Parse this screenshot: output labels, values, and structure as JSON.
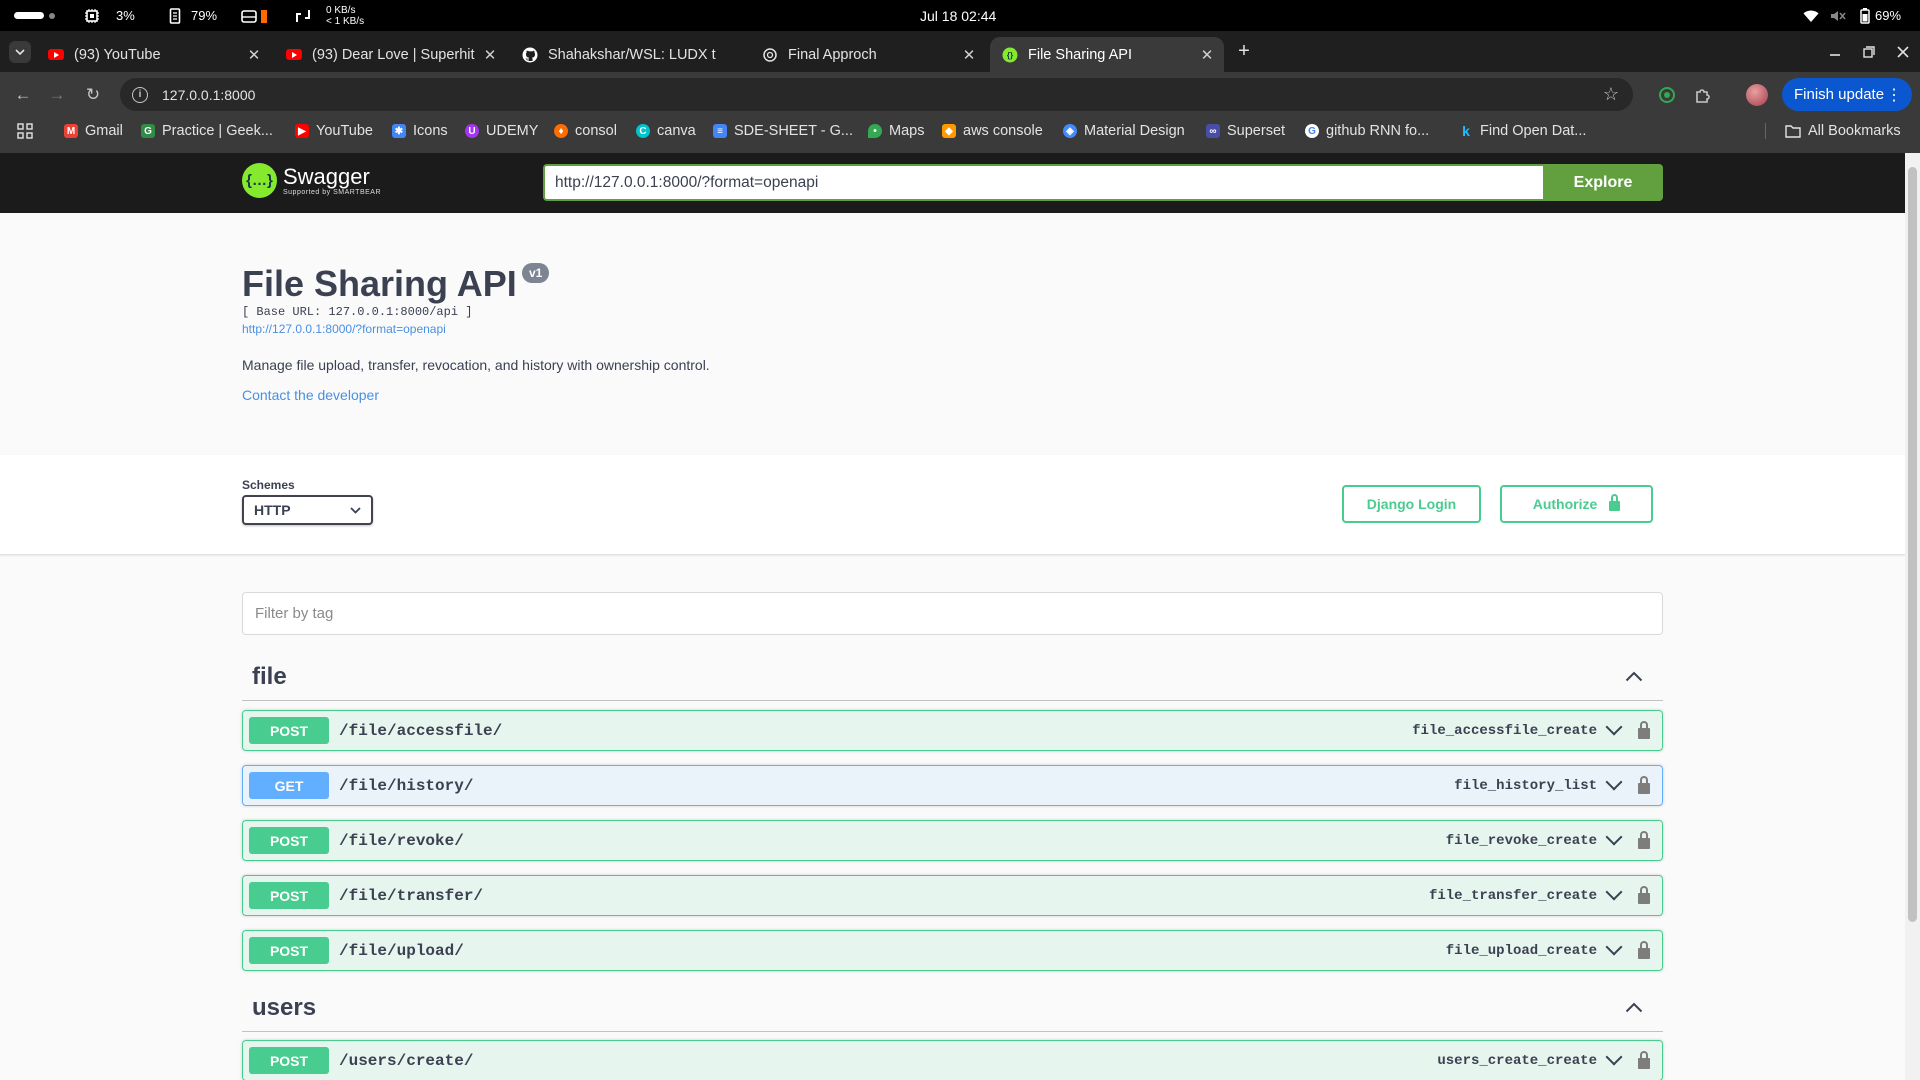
{
  "os": {
    "cpu": "3%",
    "memory": "79%",
    "net_down": "0 KB/s",
    "net_up": "< 1 KB/s",
    "datetime": "Jul 18  02:44",
    "battery": "69%"
  },
  "tabs": [
    {
      "title": "(93) YouTube",
      "icon": "youtube-icon"
    },
    {
      "title": "(93) Dear Love | Superhit",
      "icon": "youtube-icon"
    },
    {
      "title": "Shahakshar/WSL: LUDX t",
      "icon": "github-icon"
    },
    {
      "title": "Final Approch",
      "icon": "chatgpt-icon"
    },
    {
      "title": "File Sharing API",
      "icon": "swagger-icon"
    }
  ],
  "toolbar": {
    "url": "127.0.0.1:8000",
    "finish_update": "Finish update"
  },
  "bookmarks": [
    {
      "label": "Gmail",
      "color": "#ea4335"
    },
    {
      "label": "Practice | Geek...",
      "color": "#2f8d46"
    },
    {
      "label": "YouTube",
      "color": "#ff0000"
    },
    {
      "label": "Icons",
      "color": "#4285f4"
    },
    {
      "label": "UDEMY",
      "color": "#a435f0"
    },
    {
      "label": "consol",
      "color": "#ff6d00"
    },
    {
      "label": "canva",
      "color": "#00c4cc"
    },
    {
      "label": "SDE-SHEET - G...",
      "color": "#4285f4"
    },
    {
      "label": "Maps",
      "color": "#34a853"
    },
    {
      "label": "aws console",
      "color": "#ff9900"
    },
    {
      "label": "Material Design",
      "color": "#448aff"
    },
    {
      "label": "Superset",
      "color": "#484ea7"
    },
    {
      "label": "github RNN fo...",
      "color": "#ffffff"
    },
    {
      "label": "Find Open Dat...",
      "color": "#20beff"
    }
  ],
  "all_bookmarks": "All Bookmarks",
  "swagger": {
    "brand": "Swagger",
    "brand_sub": "Supported by SMARTBEAR",
    "spec_url": "http://127.0.0.1:8000/?format=openapi",
    "explore": "Explore"
  },
  "api": {
    "title": "File Sharing API",
    "version": "v1",
    "base_url": "[ Base URL: 127.0.0.1:8000/api ]",
    "spec_link": "http://127.0.0.1:8000/?format=openapi",
    "description": "Manage file upload, transfer, revocation, and history with ownership control.",
    "contact": "Contact the developer"
  },
  "schemes": {
    "label": "Schemes",
    "selected": "HTTP",
    "django_login": "Django Login",
    "authorize": "Authorize"
  },
  "filter_placeholder": "Filter by tag",
  "tags": [
    {
      "name": "file",
      "operations": [
        {
          "method": "POST",
          "path": "/file/accessfile/",
          "op_id": "file_accessfile_create"
        },
        {
          "method": "GET",
          "path": "/file/history/",
          "op_id": "file_history_list"
        },
        {
          "method": "POST",
          "path": "/file/revoke/",
          "op_id": "file_revoke_create"
        },
        {
          "method": "POST",
          "path": "/file/transfer/",
          "op_id": "file_transfer_create"
        },
        {
          "method": "POST",
          "path": "/file/upload/",
          "op_id": "file_upload_create"
        }
      ]
    },
    {
      "name": "users",
      "operations": [
        {
          "method": "POST",
          "path": "/users/create/",
          "op_id": "users_create_create"
        }
      ]
    }
  ]
}
